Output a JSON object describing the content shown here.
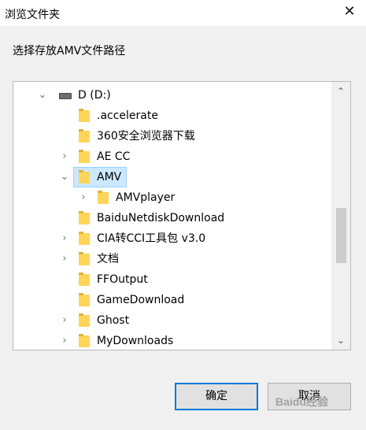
{
  "window": {
    "title": "浏览文件夹",
    "close_icon": "close-icon",
    "prompt": "选择存放AMV文件路径"
  },
  "tree": {
    "drive": {
      "label": "D (D:)",
      "expanded": true,
      "icon": "drive-icon"
    },
    "items": [
      {
        "label": ".accelerate",
        "expandable": false
      },
      {
        "label": "360安全浏览器下载",
        "expandable": false
      },
      {
        "label": "AE CC",
        "expandable": true
      },
      {
        "label": "AMV",
        "expandable": true,
        "expanded": true,
        "selected": true
      },
      {
        "label": "AMVplayer",
        "expandable": true,
        "child": true
      },
      {
        "label": "BaiduNetdiskDownload",
        "expandable": false
      },
      {
        "label": "CIA转CCI工具包 v3.0",
        "expandable": true
      },
      {
        "label": "文档",
        "expandable": true
      },
      {
        "label": "FFOutput",
        "expandable": false
      },
      {
        "label": "GameDownload",
        "expandable": false
      },
      {
        "label": "Ghost",
        "expandable": true
      },
      {
        "label": "MyDownloads",
        "expandable": true
      }
    ]
  },
  "buttons": {
    "ok": "确定",
    "cancel": "取消"
  },
  "watermark": "Baidu经验",
  "colors": {
    "selection": "#cce8ff",
    "folder": "#ffd557",
    "primary_border": "#0078d7"
  }
}
